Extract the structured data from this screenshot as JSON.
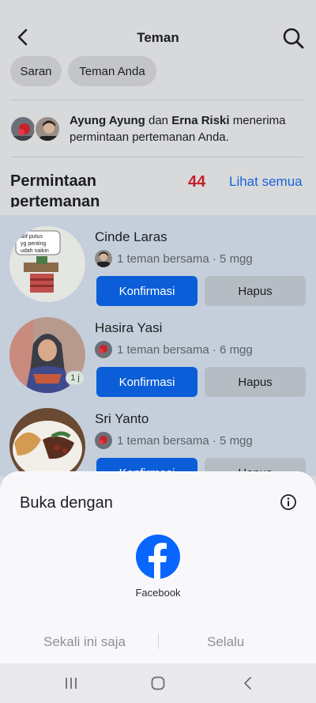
{
  "header": {
    "title": "Teman"
  },
  "chips": [
    "Saran",
    "Teman Anda"
  ],
  "notification": {
    "name1": "Ayung Ayung",
    "conj": " dan ",
    "name2": "Erna Riski",
    "rest": " menerima permintaan pertemanan Anda."
  },
  "requests_section": {
    "title": "Permintaan pertemanan",
    "count": "44",
    "see_all": "Lihat semua"
  },
  "requests": [
    {
      "name": "Cinde Laras",
      "mutual": "1 teman bersama · 5 mgg",
      "confirm": "Konfirmasi",
      "delete": "Hapus",
      "image_text": "alif putus yg penting udah naikin"
    },
    {
      "name": "Hasira Yasi",
      "mutual": "1 teman bersama · 6 mgg",
      "confirm": "Konfirmasi",
      "delete": "Hapus",
      "badge": "1 j"
    },
    {
      "name": "Sri Yanto",
      "mutual": "1 teman bersama · 5 mgg",
      "confirm": "Konfirmasi",
      "delete": "Hapus"
    }
  ],
  "sheet": {
    "title": "Buka dengan",
    "app_label": "Facebook",
    "option_once": "Sekali ini saja",
    "option_always": "Selalu"
  },
  "colors": {
    "accent": "#0b5ed7",
    "count": "#c4202a",
    "link": "#1565d8",
    "facebook": "#0866ff"
  }
}
